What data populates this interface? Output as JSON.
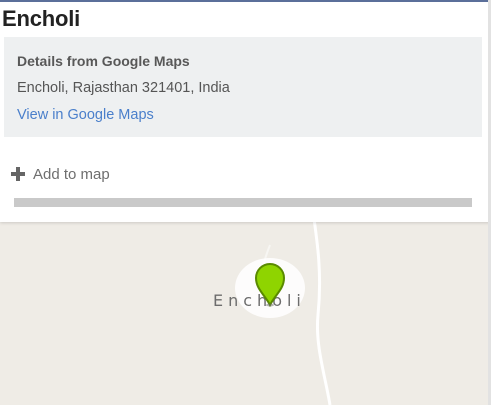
{
  "card": {
    "title": "Encholi",
    "details_heading": "Details from Google Maps",
    "address": "Encholi, Rajasthan 321401, India",
    "view_link": "View in Google Maps",
    "add_to_map": "Add to map"
  },
  "map": {
    "place_label": "Encholi",
    "marker_color": "#8fd400",
    "background_color": "#efece6"
  },
  "colors": {
    "link": "#4a7fcb",
    "title": "#222222",
    "details_bg": "#eef0f1"
  },
  "icons": {
    "add": "plus-icon",
    "marker": "map-pin-icon"
  }
}
